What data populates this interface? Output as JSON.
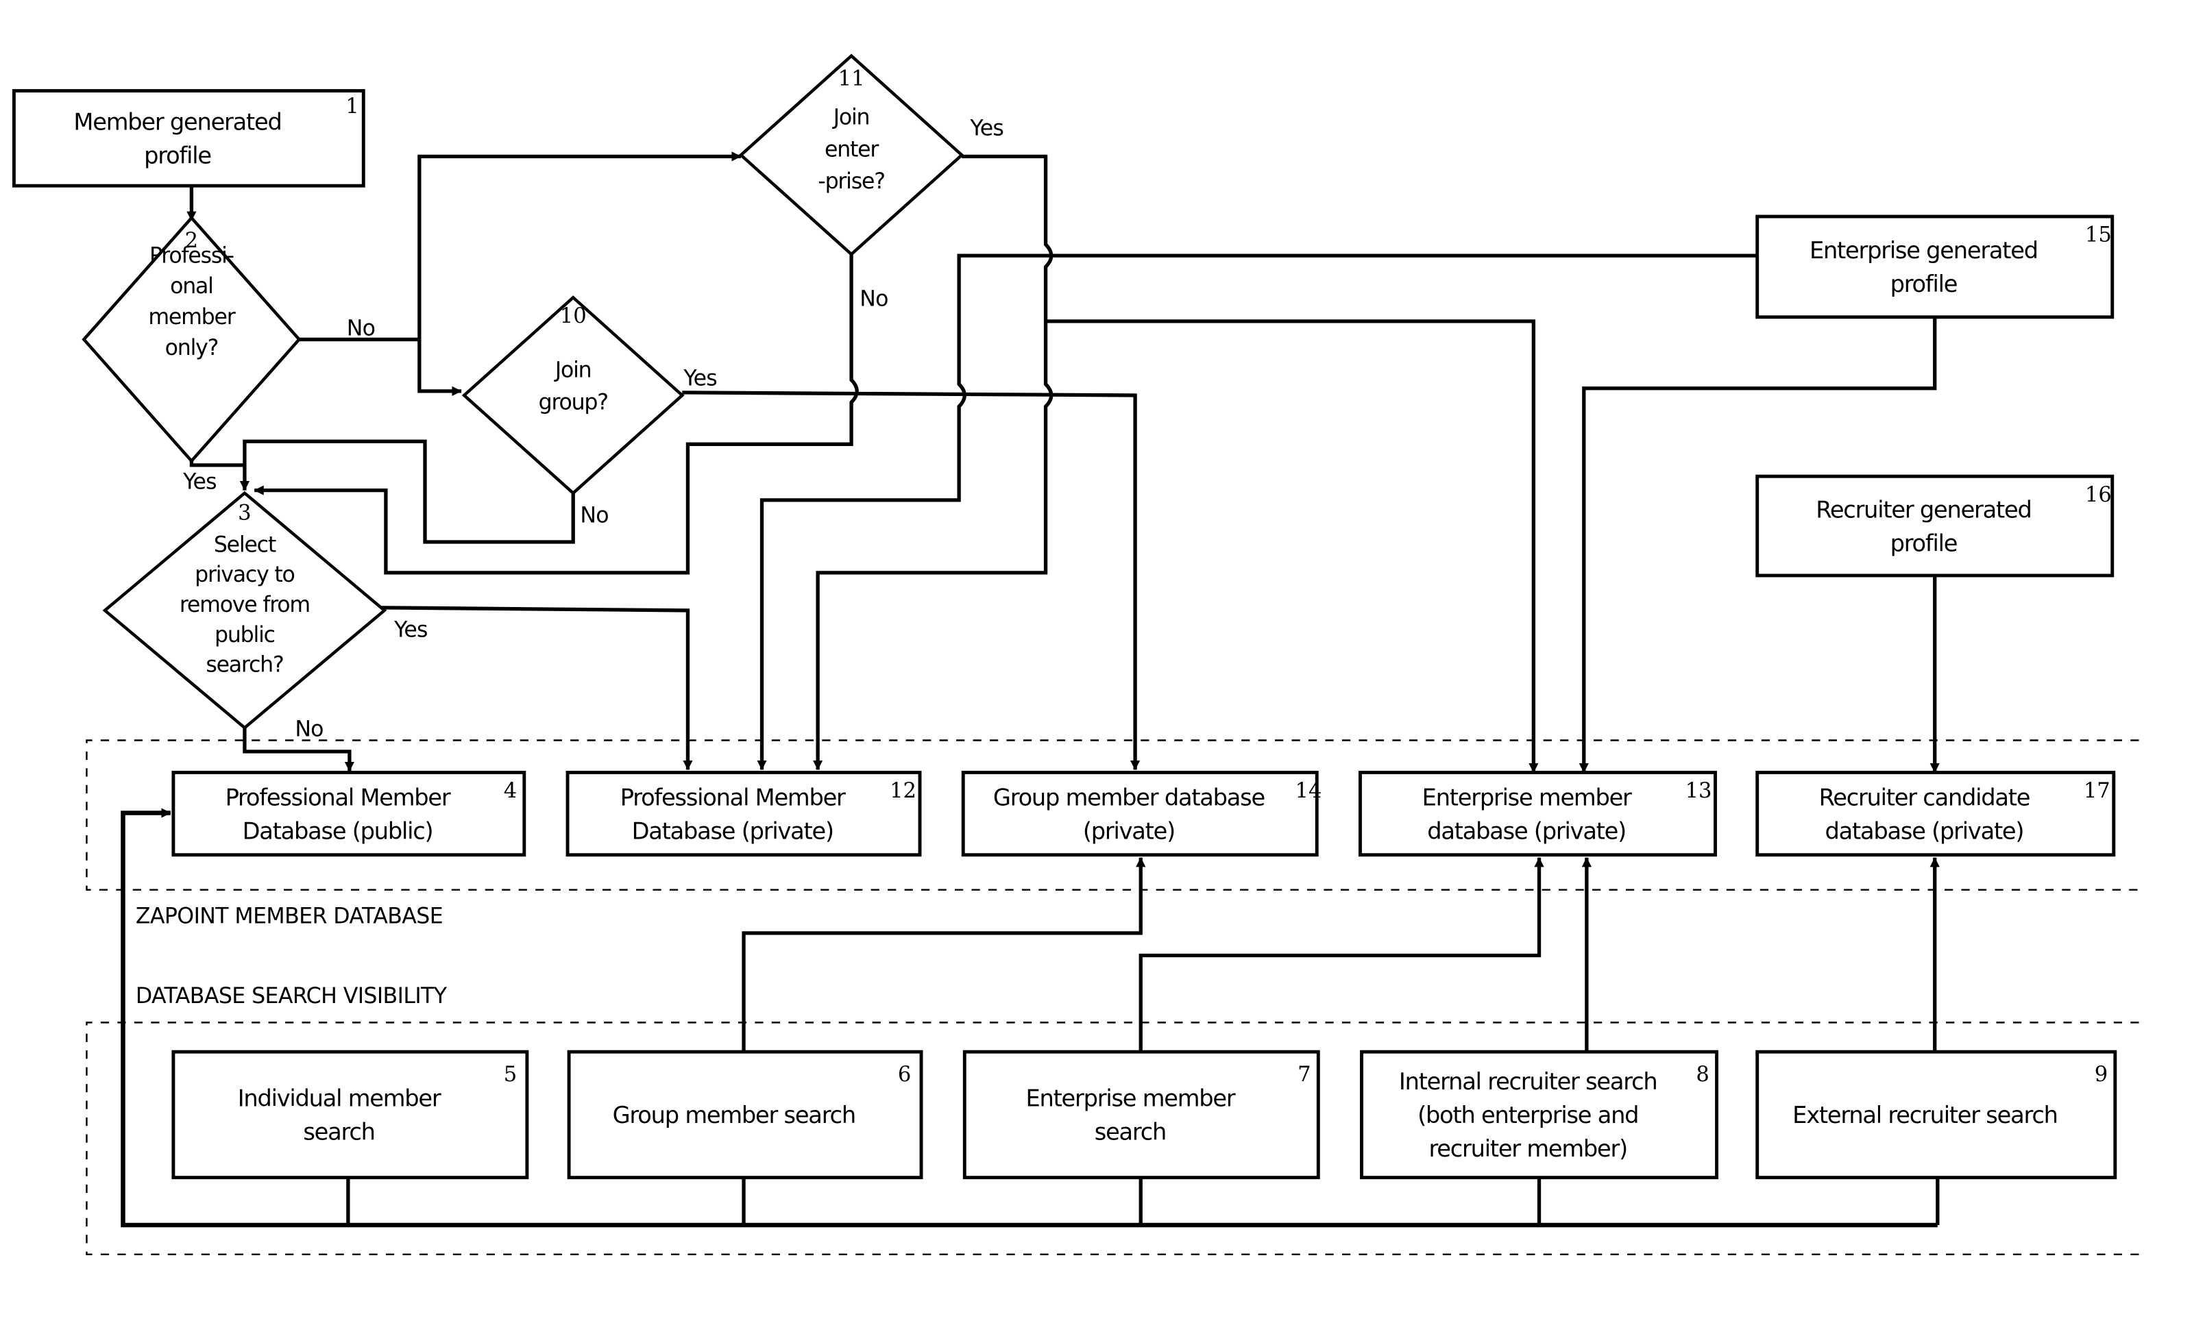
{
  "diagram": {
    "regions": {
      "member_database": "ZAPOINT MEMBER DATABASE",
      "search_visibility": "DATABASE SEARCH VISIBILITY"
    },
    "nodes": {
      "n1": {
        "number": "1",
        "type": "process",
        "lines": [
          "Member generated",
          "profile"
        ]
      },
      "n2": {
        "number": "2",
        "type": "decision",
        "lines": [
          "Professi-",
          "onal",
          "member",
          "only?"
        ]
      },
      "n3": {
        "number": "3",
        "type": "decision",
        "lines": [
          "Select",
          "privacy to",
          "remove from",
          "public",
          "search?"
        ]
      },
      "n10": {
        "number": "10",
        "type": "decision",
        "lines": [
          "Join",
          "group?"
        ]
      },
      "n11": {
        "number": "11",
        "type": "decision",
        "lines": [
          "Join",
          "enter",
          "-prise?"
        ]
      },
      "n15": {
        "number": "15",
        "type": "process",
        "lines": [
          "Enterprise generated",
          "profile"
        ]
      },
      "n16": {
        "number": "16",
        "type": "process",
        "lines": [
          "Recruiter generated",
          "profile"
        ]
      },
      "n4": {
        "number": "4",
        "type": "database",
        "lines": [
          "Professional Member",
          "Database (public)"
        ]
      },
      "n12": {
        "number": "12",
        "type": "database",
        "lines": [
          "Professional Member",
          "Database (private)"
        ]
      },
      "n14": {
        "number": "14",
        "type": "database",
        "lines": [
          "Group member database",
          "(private)"
        ]
      },
      "n13": {
        "number": "13",
        "type": "database",
        "lines": [
          "Enterprise member",
          "database (private)"
        ]
      },
      "n17": {
        "number": "17",
        "type": "database",
        "lines": [
          "Recruiter candidate",
          "database (private)"
        ]
      },
      "n5": {
        "number": "5",
        "type": "search",
        "lines": [
          "Individual member",
          "search"
        ]
      },
      "n6": {
        "number": "6",
        "type": "search",
        "lines": [
          "Group member search"
        ]
      },
      "n7": {
        "number": "7",
        "type": "search",
        "lines": [
          "Enterprise member",
          "search"
        ]
      },
      "n8": {
        "number": "8",
        "type": "search",
        "lines": [
          "Internal recruiter search",
          "(both enterprise and",
          "recruiter member)"
        ]
      },
      "n9": {
        "number": "9",
        "type": "search",
        "lines": [
          "External recruiter search"
        ]
      }
    },
    "edge_labels": {
      "n2_no": "No",
      "n2_yes": "Yes",
      "n10_yes": "Yes",
      "n10_no": "No",
      "n11_yes": "Yes",
      "n11_no": "No",
      "n3_yes": "Yes",
      "n3_no": "No"
    },
    "edges": [
      {
        "from": "n1",
        "to": "n2"
      },
      {
        "from": "n2",
        "to": "n11",
        "label": "No"
      },
      {
        "from": "n2",
        "to": "n10",
        "label": "No"
      },
      {
        "from": "n2",
        "to": "n3",
        "label": "Yes"
      },
      {
        "from": "n10",
        "to": "n14",
        "label": "Yes"
      },
      {
        "from": "n10",
        "to": "n3",
        "label": "No"
      },
      {
        "from": "n11",
        "to": "n12",
        "label": "Yes"
      },
      {
        "from": "n11",
        "to": "n13",
        "label": "Yes"
      },
      {
        "from": "n11",
        "to": "n3",
        "label": "No"
      },
      {
        "from": "n15",
        "to": "n12"
      },
      {
        "from": "n15",
        "to": "n13"
      },
      {
        "from": "n16",
        "to": "n17"
      },
      {
        "from": "n3",
        "to": "n12",
        "label": "Yes"
      },
      {
        "from": "n3",
        "to": "n4",
        "label": "No"
      },
      {
        "from": "n6",
        "to": "n14"
      },
      {
        "from": "n7",
        "to": "n13"
      },
      {
        "from": "n8",
        "to": "n13"
      },
      {
        "from": "n9",
        "to": "n17"
      },
      {
        "from": "search_bus",
        "to": "n4"
      }
    ]
  }
}
